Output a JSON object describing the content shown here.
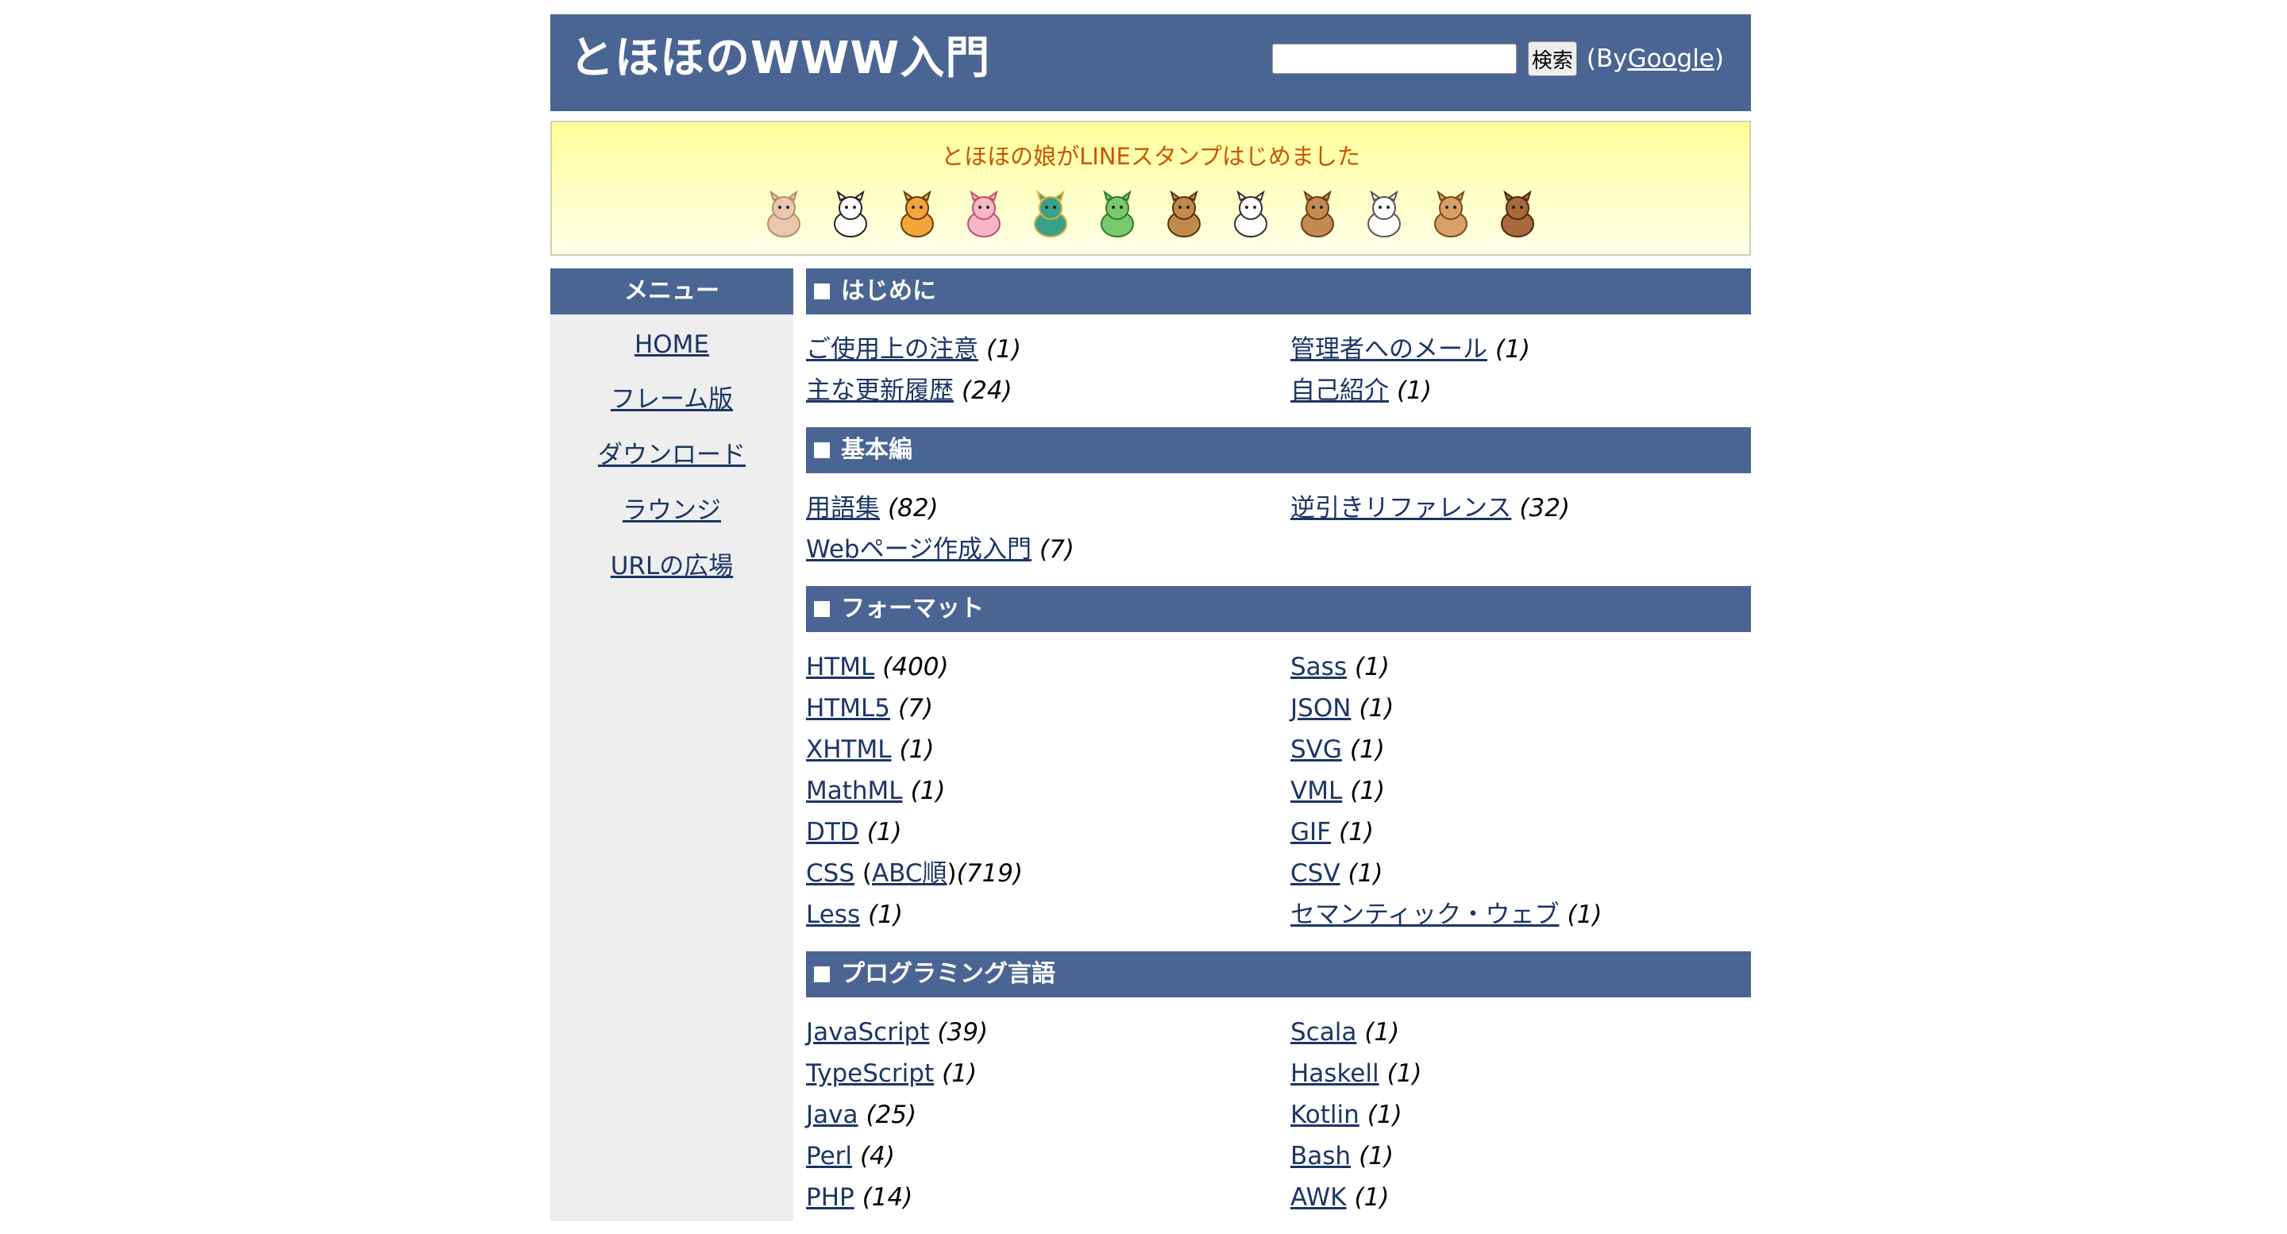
{
  "header": {
    "title": "とほほのWWW入門",
    "search_button": "検索",
    "by_prefix": "(By ",
    "by_link": "Google",
    "by_suffix": ")"
  },
  "banner": {
    "text": "とほほの娘がLINEスタンプはじめました",
    "stamps": [
      "mouse",
      "cow",
      "tiger",
      "rabbit",
      "dragon",
      "snake",
      "horse",
      "sheep",
      "monkey",
      "rooster",
      "dog",
      "boar"
    ],
    "stamp_icons": [
      "mouse-stamp-icon",
      "cow-stamp-icon",
      "tiger-stamp-icon",
      "rabbit-stamp-icon",
      "dragon-stamp-icon",
      "snake-stamp-icon",
      "horse-stamp-icon",
      "sheep-stamp-icon",
      "monkey-stamp-icon",
      "rooster-stamp-icon",
      "dog-stamp-icon",
      "boar-stamp-icon"
    ]
  },
  "menu": {
    "title": "メニュー",
    "items": [
      "HOME",
      "フレーム版",
      "ダウンロード",
      "ラウンジ",
      "URLの広場"
    ]
  },
  "sections": [
    {
      "title": "はじめに",
      "items": [
        {
          "label": "ご使用上の注意",
          "count": "(1)"
        },
        {
          "label": "管理者へのメール",
          "count": "(1)"
        },
        {
          "label": "主な更新履歴",
          "count": "(24)"
        },
        {
          "label": "自己紹介",
          "count": "(1)"
        }
      ]
    },
    {
      "title": "基本編",
      "items": [
        {
          "label": "用語集",
          "count": "(82)"
        },
        {
          "label": "逆引きリファレンス",
          "count": "(32)"
        },
        {
          "label": "Webページ作成入門",
          "count": "(7)"
        }
      ]
    },
    {
      "title": "フォーマット",
      "items": [
        {
          "label": "HTML",
          "count": "(400)"
        },
        {
          "label": "Sass",
          "count": "(1)"
        },
        {
          "label": "HTML5",
          "count": "(7)"
        },
        {
          "label": "JSON",
          "count": "(1)"
        },
        {
          "label": "XHTML",
          "count": "(1)"
        },
        {
          "label": "SVG",
          "count": "(1)"
        },
        {
          "label": "MathML",
          "count": "(1)"
        },
        {
          "label": "VML",
          "count": "(1)"
        },
        {
          "label": "DTD",
          "count": "(1)"
        },
        {
          "label": "GIF",
          "count": "(1)"
        },
        {
          "label": "CSS",
          "extra": "ABC順",
          "count": "(719)"
        },
        {
          "label": "CSV",
          "count": "(1)"
        },
        {
          "label": "Less",
          "count": "(1)"
        },
        {
          "label": "セマンティック・ウェブ",
          "count": "(1)"
        }
      ]
    },
    {
      "title": "プログラミング言語",
      "items": [
        {
          "label": "JavaScript",
          "count": "(39)"
        },
        {
          "label": "Scala",
          "count": "(1)"
        },
        {
          "label": "TypeScript",
          "count": "(1)"
        },
        {
          "label": "Haskell",
          "count": "(1)"
        },
        {
          "label": "Java",
          "count": "(25)"
        },
        {
          "label": "Kotlin",
          "count": "(1)"
        },
        {
          "label": "Perl",
          "count": "(4)"
        },
        {
          "label": "Bash",
          "count": "(1)"
        },
        {
          "label": "PHP",
          "count": "(14)"
        },
        {
          "label": "AWK",
          "count": "(1)"
        }
      ]
    }
  ]
}
